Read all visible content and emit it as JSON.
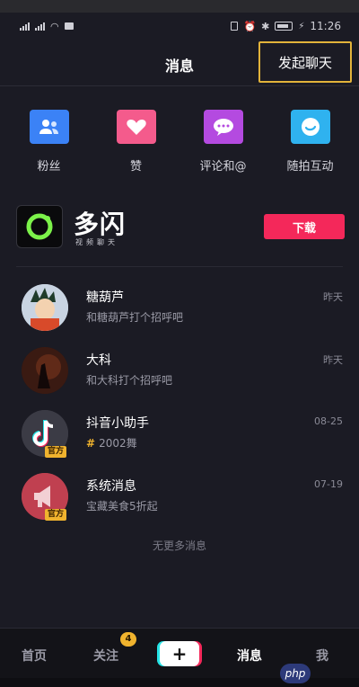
{
  "status_bar": {
    "time": "11:26"
  },
  "header": {
    "title": "消息",
    "start_chat_label": "发起聊天"
  },
  "quick_actions": [
    {
      "label": "粉丝",
      "icon": "fans-icon",
      "color": "#3b82f6"
    },
    {
      "label": "赞",
      "icon": "heart-icon",
      "color": "#f45b8c"
    },
    {
      "label": "评论和@",
      "icon": "comment-icon",
      "color": "#b44ae0"
    },
    {
      "label": "随拍互动",
      "icon": "snap-icon",
      "color": "#2fb2ef"
    }
  ],
  "ad": {
    "brand": "多闪",
    "slogan": "视频聊天",
    "download_label": "下载"
  },
  "conversations": [
    {
      "name": "糖葫芦",
      "preview": "和糖葫芦打个招呼吧",
      "time": "昨天",
      "official": false
    },
    {
      "name": "大科",
      "preview": "和大科打个招呼吧",
      "time": "昨天",
      "official": false
    },
    {
      "name": "抖音小助手",
      "preview": "2002舞",
      "preview_prefix": "#",
      "time": "08-25",
      "official": true,
      "official_label": "官方"
    },
    {
      "name": "系统消息",
      "preview": "宝藏美食5折起",
      "time": "07-19",
      "official": true,
      "official_label": "官方"
    }
  ],
  "no_more_text": "无更多消息",
  "tabbar": {
    "home": "首页",
    "following": "关注",
    "following_badge": "4",
    "plus": "+",
    "messages": "消息",
    "me": "我"
  },
  "watermark": "php",
  "colors": {
    "accent": "#f4285a",
    "highlight": "#e2b33a",
    "badge": "#f0b32e"
  }
}
